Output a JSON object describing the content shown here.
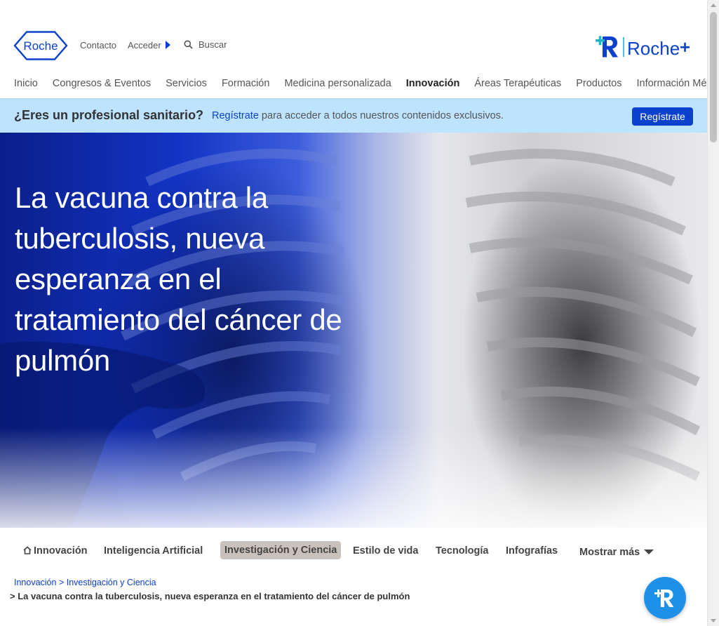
{
  "header": {
    "logo_text": "Roche",
    "contacto": "Contacto",
    "acceder": "Acceder",
    "search_placeholder": "Buscar",
    "rplus_text": "Roche"
  },
  "nav": [
    {
      "label": "Inicio",
      "active": false
    },
    {
      "label": "Congresos & Eventos",
      "active": false
    },
    {
      "label": "Servicios",
      "active": false
    },
    {
      "label": "Formación",
      "active": false
    },
    {
      "label": "Medicina personalizada",
      "active": false
    },
    {
      "label": "Innovación",
      "active": true
    },
    {
      "label": "Áreas Terapéuticas",
      "active": false
    },
    {
      "label": "Productos",
      "active": false
    },
    {
      "label": "Información Médica",
      "active": false
    }
  ],
  "pro_banner": {
    "question": "¿Eres un profesional sanitario?",
    "link": "Regístrate",
    "text": " para acceder a todos nuestros contenidos exclusivos.",
    "button": "Regístrate"
  },
  "hero": {
    "title": "La vacuna contra la tuberculosis, nueva esperanza en el tratamiento del cáncer de pulmón"
  },
  "sub_nav": [
    {
      "label": "Innovación",
      "active": false
    },
    {
      "label": "Inteligencia Artificial",
      "active": false
    },
    {
      "label": "Investigación y Ciencia",
      "active": true
    },
    {
      "label": "Estilo de vida",
      "active": false
    },
    {
      "label": "Tecnología",
      "active": false
    },
    {
      "label": "Infografías",
      "active": false
    },
    {
      "label": "Mostrar más",
      "active": false
    }
  ],
  "breadcrumb": {
    "items": [
      "Innovación",
      "Investigación y Ciencia"
    ],
    "separator": ">",
    "current": "> La vacuna contra la tuberculosis, nueva esperanza en el tratamiento del cáncer de pulmón"
  },
  "colors": {
    "brand_blue": "#0b41cd",
    "banner_bg": "#bde3ff",
    "active_chip": "#c9c2bc",
    "fab": "#1e90e8",
    "rplus_teal": "#1fb5c8"
  }
}
